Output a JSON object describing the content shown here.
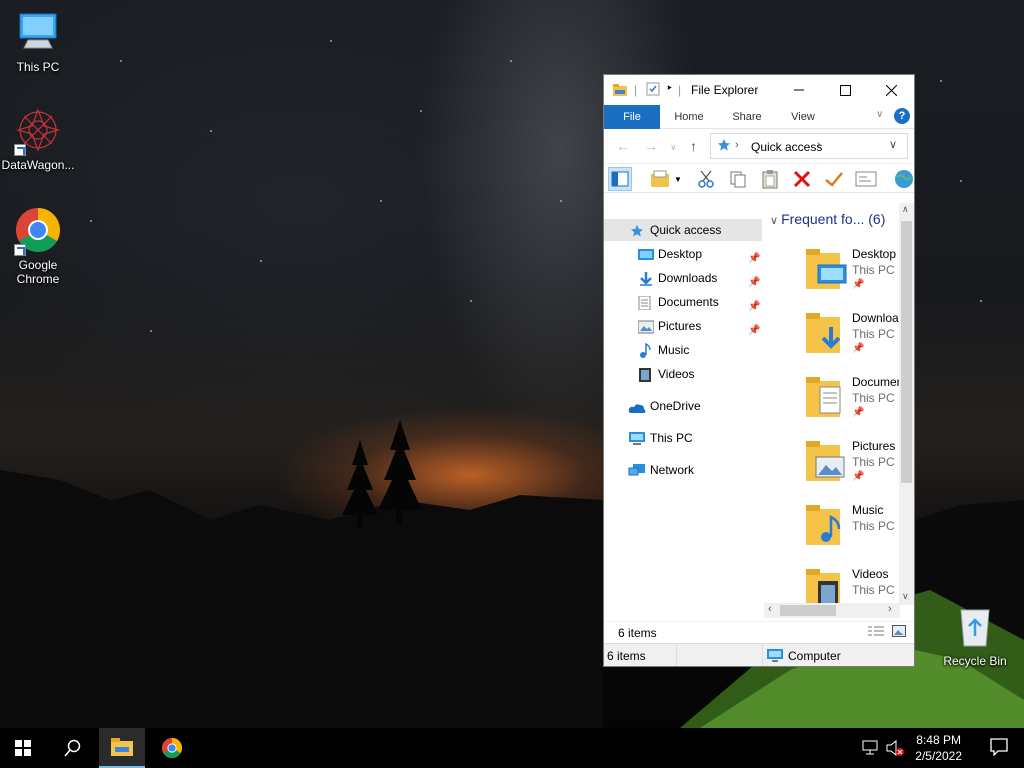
{
  "desktop": {
    "icons": [
      {
        "label": "This PC"
      },
      {
        "label": "DataWagon..."
      },
      {
        "label": "Google Chrome"
      },
      {
        "label": "Recycle Bin"
      }
    ]
  },
  "explorer": {
    "title": "File Explorer",
    "ribbon_tabs": [
      "File",
      "Home",
      "Share",
      "View"
    ],
    "address": "Quick access",
    "nav": [
      {
        "label": "Quick access",
        "icon": "star-icon",
        "pinned": false,
        "selected": true
      },
      {
        "label": "Desktop",
        "icon": "desktop-folder-icon",
        "pinned": true
      },
      {
        "label": "Downloads",
        "icon": "downloads-icon",
        "pinned": true
      },
      {
        "label": "Documents",
        "icon": "documents-icon",
        "pinned": true
      },
      {
        "label": "Pictures",
        "icon": "pictures-icon",
        "pinned": true
      },
      {
        "label": "Music",
        "icon": "music-icon",
        "pinned": false
      },
      {
        "label": "Videos",
        "icon": "videos-icon",
        "pinned": false
      },
      {
        "label": "OneDrive",
        "icon": "onedrive-icon",
        "pinned": false
      },
      {
        "label": "This PC",
        "icon": "this-pc-icon",
        "pinned": false
      },
      {
        "label": "Network",
        "icon": "network-icon",
        "pinned": false
      }
    ],
    "group_header": "Frequent fo... (6)",
    "folders": [
      {
        "name": "Desktop",
        "location": "This PC"
      },
      {
        "name": "Downloads",
        "location": "This PC"
      },
      {
        "name": "Documents",
        "location": "This PC"
      },
      {
        "name": "Pictures",
        "location": "This PC"
      },
      {
        "name": "Music",
        "location": "This PC"
      },
      {
        "name": "Videos",
        "location": "This PC"
      }
    ],
    "status_items": "6 items",
    "status_bar_items": "6 items",
    "status_computer": "Computer"
  },
  "taskbar": {
    "time": "8:48 PM",
    "date": "2/5/2022"
  },
  "colors": {
    "accent": "#1a6fc3",
    "group_header": "#1e3287"
  }
}
